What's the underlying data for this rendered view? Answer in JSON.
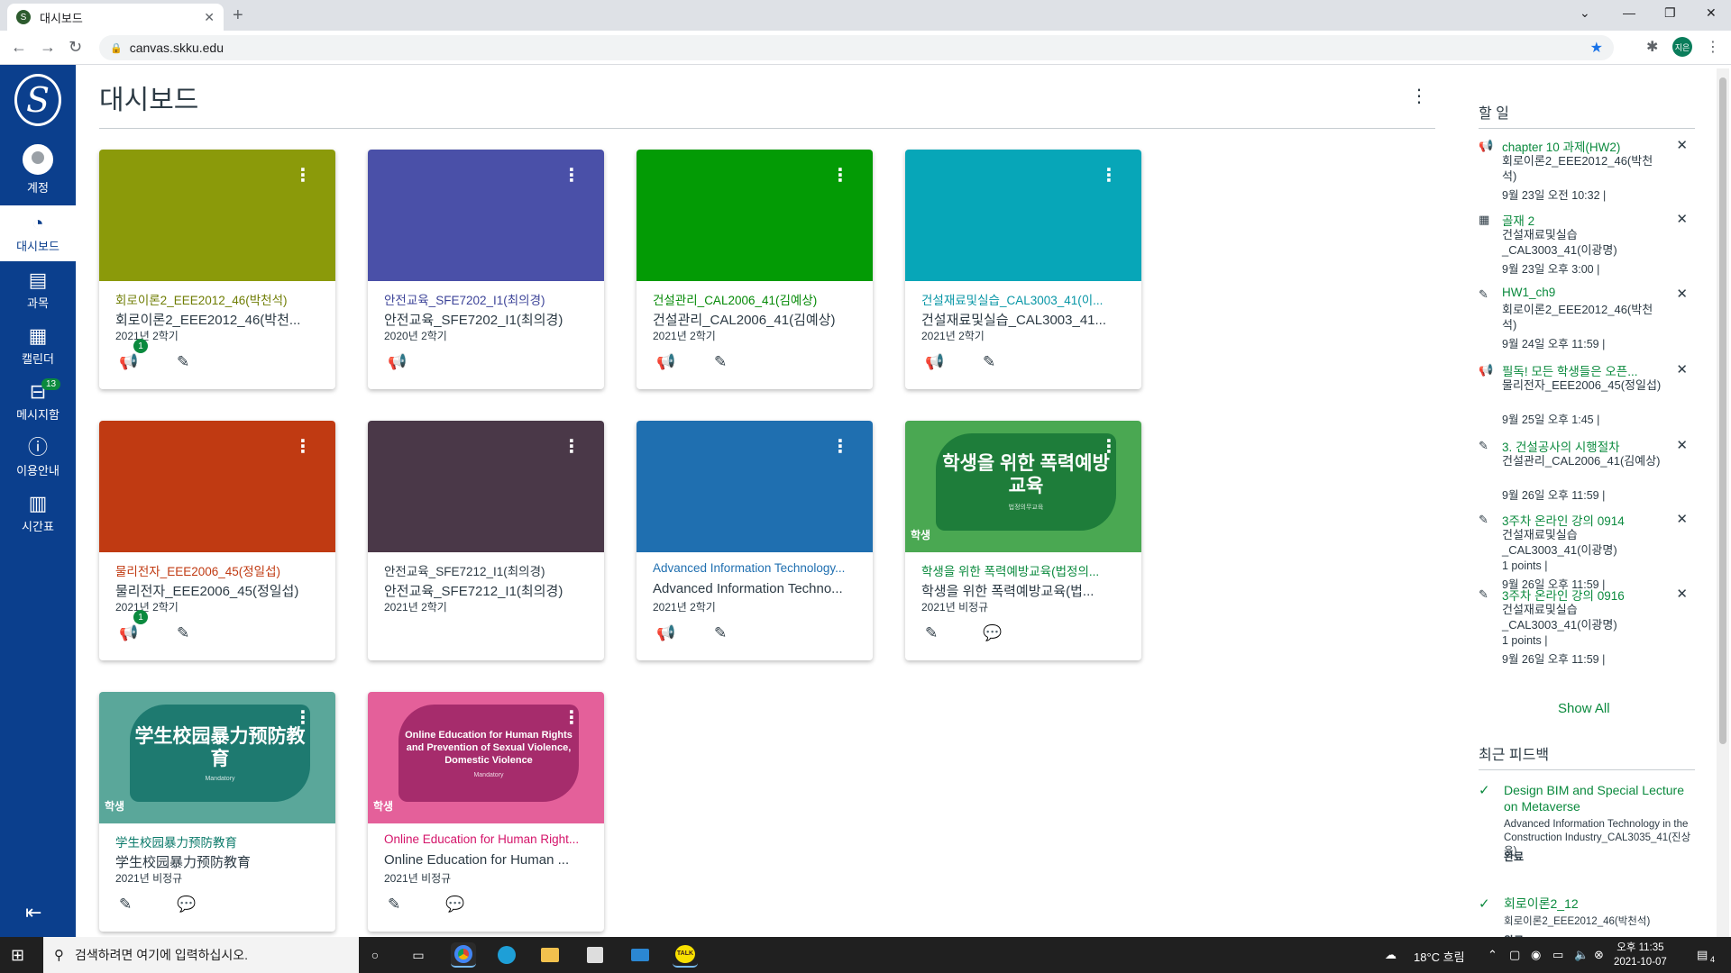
{
  "browser": {
    "tab_title": "대시보드",
    "url": "canvas.skku.edu",
    "profile_initials": "지은"
  },
  "sidebar": {
    "items": [
      {
        "label": "계정",
        "icon": "user-avatar-icon"
      },
      {
        "label": "대시보드",
        "icon": "dashboard-gauge-icon"
      },
      {
        "label": "과목",
        "icon": "book-icon"
      },
      {
        "label": "캘린더",
        "icon": "calendar-icon"
      },
      {
        "label": "메시지함",
        "icon": "inbox-icon",
        "badge": "13"
      },
      {
        "label": "이용안내",
        "icon": "help-icon"
      },
      {
        "label": "시간표",
        "icon": "timetable-icon"
      }
    ],
    "logo_text": "S"
  },
  "dashboard": {
    "title": "대시보드",
    "cards": [
      {
        "title": "회로이론2_EEE2012_46(박천석)",
        "subtitle": "회로이론2_EEE2012_46(박천...",
        "term": "2021년 2학기",
        "color": "#8b9a0a",
        "title_color": "#6f7d04",
        "badge": "1",
        "icons": [
          "announcement-icon",
          "assignment-icon"
        ]
      },
      {
        "title": "안전교육_SFE7202_I1(최의경)",
        "subtitle": "안전교육_SFE7202_I1(최의경)",
        "term": "2020년 2학기",
        "color": "#4a50a8",
        "title_color": "#3c4398",
        "icons": [
          "announcement-icon"
        ]
      },
      {
        "title": "건설관리_CAL2006_41(김예상)",
        "subtitle": "건설관리_CAL2006_41(김예상)",
        "term": "2021년 2학기",
        "color": "#039b05",
        "title_color": "#058a07",
        "icons": [
          "announcement-icon",
          "assignment-icon"
        ]
      },
      {
        "title": "건설재료및실습_CAL3003_41(이...",
        "subtitle": "건설재료및실습_CAL3003_41...",
        "term": "2021년 2학기",
        "color": "#07a6b8",
        "title_color": "#0796a6",
        "icons": [
          "announcement-icon",
          "assignment-icon"
        ]
      },
      {
        "title": "물리전자_EEE2006_45(정일섭)",
        "subtitle": "물리전자_EEE2006_45(정일섭)",
        "term": "2021년 2학기",
        "color": "#c03a12",
        "title_color": "#c03a12",
        "badge": "1",
        "icons": [
          "announcement-icon",
          "assignment-icon"
        ]
      },
      {
        "title": "안전교육_SFE7212_I1(최의경)",
        "subtitle": "안전교육_SFE7212_I1(최의경)",
        "term": "2021년 2학기",
        "color": "#4a3848",
        "title_color": "#2d3b45",
        "icons": []
      },
      {
        "title": "Advanced Information Technology...",
        "subtitle": "Advanced Information Techno...",
        "term": "2021년 2학기",
        "color": "#1f6fb0",
        "title_color": "#1f6fb0",
        "icons": [
          "announcement-icon",
          "assignment-icon"
        ]
      },
      {
        "title": "학생을 위한 폭력예방교육(법정의...",
        "subtitle": "학생을 위한 폭력예방교육(법...",
        "term": "2021년 비정규",
        "color": "#4aa852",
        "title_color": "#0b8a3e",
        "banner": "학생을 위한 폭력예방교육",
        "banner_small": "법정의무교육",
        "banner_tag": "학생",
        "banner_color": "#1e7d3a",
        "icons": [
          "assignment-icon",
          "discussion-icon"
        ]
      },
      {
        "title": "学生校园暴力预防教育",
        "subtitle": "学生校园暴力预防教育",
        "term": "2021년 비정규",
        "color": "#5aa79a",
        "title_color": "#0b7a6a",
        "banner": "学生校园暴力预防教育",
        "banner_small": "Mandatory",
        "banner_tag": "학생",
        "banner_color": "#1e7a70",
        "icons": [
          "assignment-icon",
          "discussion-icon"
        ]
      },
      {
        "title": "Online Education for Human Right...",
        "subtitle": "Online Education for Human ...",
        "term": "2021년 비정규",
        "color": "#e4609a",
        "title_color": "#d4146a",
        "banner": "Online Education for Human Rights and Prevention of Sexual Violence, Domestic Violence",
        "banner_small": "Mandatory",
        "banner_tag": "학생",
        "banner_color": "#a62c6c",
        "icons": [
          "assignment-icon",
          "discussion-icon"
        ]
      }
    ]
  },
  "todo": {
    "heading": "할 일",
    "items": [
      {
        "icon": "announcement-icon",
        "title": "chapter 10 과제(HW2)",
        "course": "회로이론2_EEE2012_46(박천석)",
        "points": "",
        "due": "9월 23일 오전 10:32  |"
      },
      {
        "icon": "calendar-icon",
        "title": "골재 2",
        "course": "건설재료및실습_CAL3003_41(이광명)",
        "points": "",
        "due": "9월 23일 오후 3:00  |"
      },
      {
        "icon": "assignment-icon",
        "title": "HW1_ch9",
        "course": "회로이론2_EEE2012_46(박천석)",
        "points": "",
        "due": "9월 24일 오후 11:59  |"
      },
      {
        "icon": "announcement-icon",
        "title": "필독! 모든 학생들은 오픈...",
        "course": "물리전자_EEE2006_45(정일섭)",
        "points": "",
        "due": "9월 25일 오후 1:45  |"
      },
      {
        "icon": "assignment-icon",
        "title": "3. 건설공사의 시행절차",
        "course": "건설관리_CAL2006_41(김예상)",
        "points": "",
        "due": "9월 26일 오후 11:59  |"
      },
      {
        "icon": "assignment-icon",
        "title": "3주차 온라인 강의 0914",
        "course": "건설재료및실습_CAL3003_41(이광명)",
        "points": "1 points  |",
        "due": "9월 26일 오후 11:59  |"
      },
      {
        "icon": "assignment-icon",
        "title": "3주차 온라인 강의 0916",
        "course": "건설재료및실습_CAL3003_41(이광명)",
        "points": "1 points  |",
        "due": "9월 26일 오후 11:59  |"
      }
    ],
    "show_all": "Show All"
  },
  "feedback": {
    "heading": "최근 피드백",
    "items": [
      {
        "title": "Design BIM and Special Lecture on Metaverse",
        "course": "Advanced Information Technology in the Construction Industry_CAL3035_41(진상윤)",
        "status": "완료"
      },
      {
        "title": "회로이론2_12",
        "course": "회로이론2_EEE2012_46(박천석)",
        "status": "완료"
      }
    ]
  },
  "taskbar": {
    "search_placeholder": "검색하려면 여기에 입력하십시오.",
    "weather": "18°C  흐림",
    "time": "오후 11:35",
    "date": "2021-10-07",
    "notifications": "4"
  }
}
